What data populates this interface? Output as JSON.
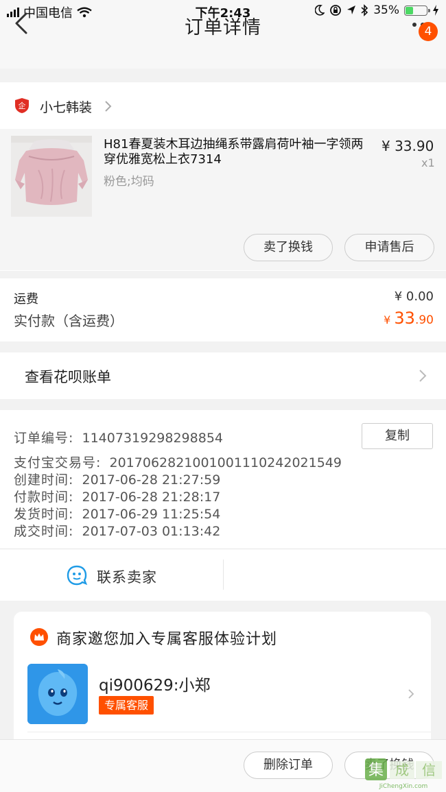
{
  "status_bar": {
    "carrier": "中国电信",
    "time": "下午2:43",
    "battery": "35%"
  },
  "nav": {
    "title": "订单详情",
    "badge_count": "4"
  },
  "shop": {
    "name": "小七韩装"
  },
  "item": {
    "title": "H81春夏装木耳边抽绳系带露肩荷叶袖一字领两穿优雅宽松上衣7314",
    "spec": "粉色;均码",
    "price": "¥ 33.90",
    "quantity": "x1",
    "sell_button": "卖了换钱",
    "service_button": "申请售后"
  },
  "totals": {
    "shipping_label": "运费",
    "shipping_value": "¥ 0.00",
    "paid_label": "实付款（含运费）",
    "paid_currency": "¥ ",
    "paid_integer": "33",
    "paid_decimal": ".90"
  },
  "huabei": {
    "label": "查看花呗账单"
  },
  "order_info": {
    "order_no_label": "订单编号:",
    "order_no": "11407319298298854",
    "copy_button": "复制",
    "alipay_label": "支付宝交易号:",
    "alipay_no": "2017062821001001110242021549",
    "created_label": "创建时间:",
    "created": "2017-06-28 21:27:59",
    "paid_label": "付款时间:",
    "paid": "2017-06-28 21:28:17",
    "shipped_label": "发货时间:",
    "shipped": "2017-06-29 11:25:54",
    "completed_label": "成交时间:",
    "completed": "2017-07-03 01:13:42"
  },
  "contact": {
    "label": "联系卖家"
  },
  "promo": {
    "title": "商家邀您加入专属客服体验计划",
    "contact_id": "qi900629:小郑",
    "tag": "专属客服"
  },
  "bottom": {
    "delete_button": "删除订单",
    "sell_button": "卖了换钱"
  },
  "icons": {
    "shop": "seller-badge-icon",
    "contact": "wangwang-icon",
    "promo": "crown-icon"
  },
  "colors": {
    "accent": "#ff5000",
    "shop_icon": "#e02e24",
    "contact_icon": "#1e9be6"
  }
}
